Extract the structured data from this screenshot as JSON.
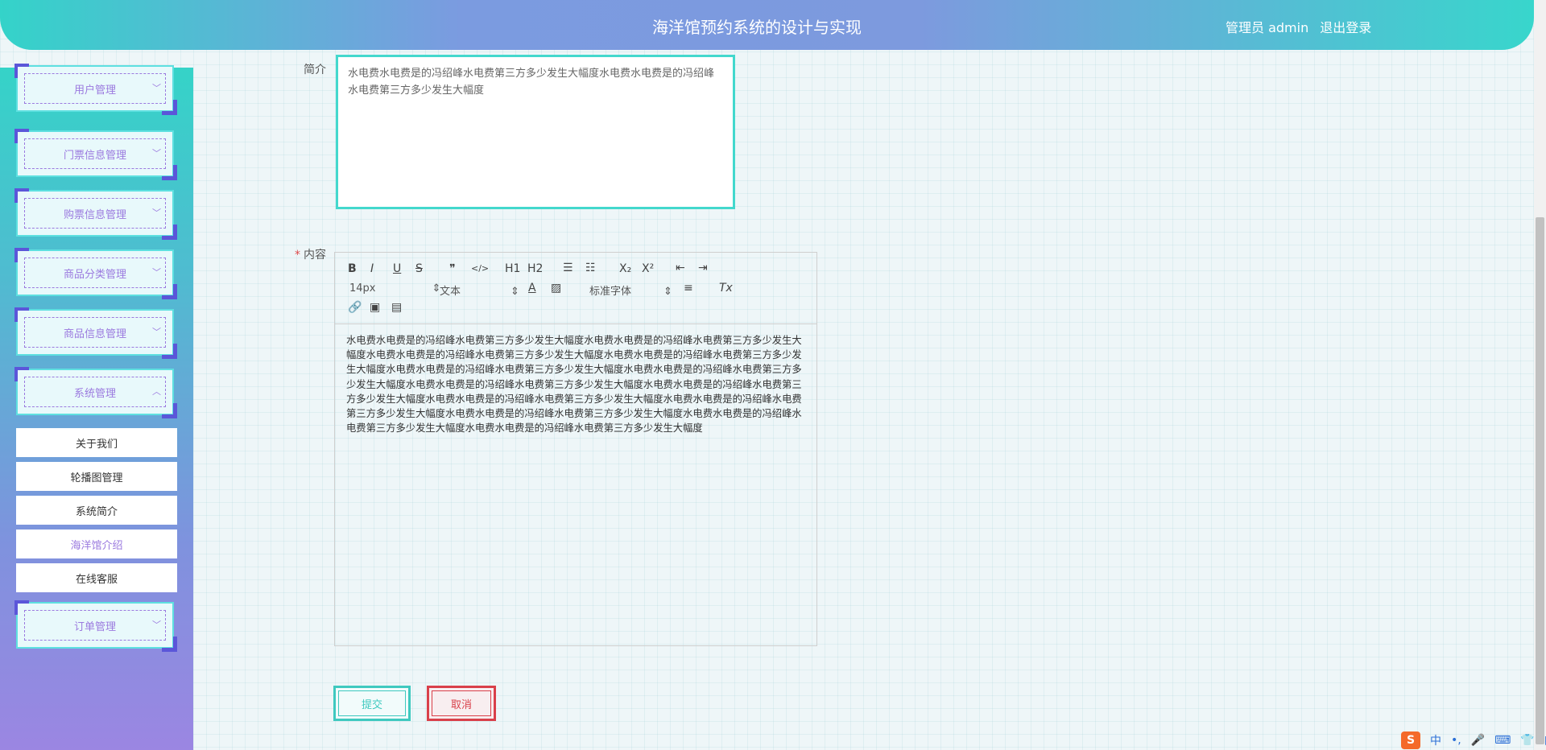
{
  "header": {
    "title": "海洋馆预约系统的设计与实现",
    "user_label": "管理员 admin",
    "logout_label": "退出登录"
  },
  "sidebar": {
    "items": [
      {
        "label": "用户管理"
      },
      {
        "label": "门票信息管理"
      },
      {
        "label": "购票信息管理"
      },
      {
        "label": "商品分类管理"
      },
      {
        "label": "商品信息管理"
      },
      {
        "label": "系统管理"
      },
      {
        "label": "订单管理"
      }
    ],
    "sub_items": [
      {
        "label": "关于我们"
      },
      {
        "label": "轮播图管理"
      },
      {
        "label": "系统简介"
      },
      {
        "label": "海洋馆介绍"
      },
      {
        "label": "在线客服"
      }
    ]
  },
  "form": {
    "summary_label": "简介",
    "summary_value": "水电费水电费是的冯绍峰水电费第三方多少发生大幅度水电费水电费是的冯绍峰水电费第三方多少发生大幅度",
    "content_label": "内容",
    "content_required_mark": "*",
    "content_value": "水电费水电费是的冯绍峰水电费第三方多少发生大幅度水电费水电费是的冯绍峰水电费第三方多少发生大幅度水电费水电费是的冯绍峰水电费第三方多少发生大幅度水电费水电费是的冯绍峰水电费第三方多少发生大幅度水电费水电费是的冯绍峰水电费第三方多少发生大幅度水电费水电费是的冯绍峰水电费第三方多少发生大幅度水电费水电费是的冯绍峰水电费第三方多少发生大幅度水电费水电费是的冯绍峰水电费第三方多少发生大幅度水电费水电费是的冯绍峰水电费第三方多少发生大幅度水电费水电费是的冯绍峰水电费第三方多少发生大幅度水电费水电费是的冯绍峰水电费第三方多少发生大幅度水电费水电费是的冯绍峰水电费第三方多少发生大幅度水电费水电费是的冯绍峰水电费第三方多少发生大幅度",
    "submit_label": "提交",
    "cancel_label": "取消"
  },
  "editor": {
    "font_size": "14px",
    "text_type": "文本",
    "font_family": "标准字体",
    "toolbar_labels": {
      "bold": "B",
      "italic": "I",
      "underline": "U",
      "strike": "S",
      "quote": "❞",
      "code": "</>",
      "h1": "H1",
      "h2": "H2",
      "sub": "X₂",
      "sup": "X²",
      "color": "A",
      "clean": "Tx"
    }
  },
  "tray": {
    "logo": "S",
    "lang": "中"
  },
  "colors": {
    "accent_teal": "#3fc9bf",
    "accent_purple": "#9b7adf",
    "danger": "#d9404a"
  }
}
